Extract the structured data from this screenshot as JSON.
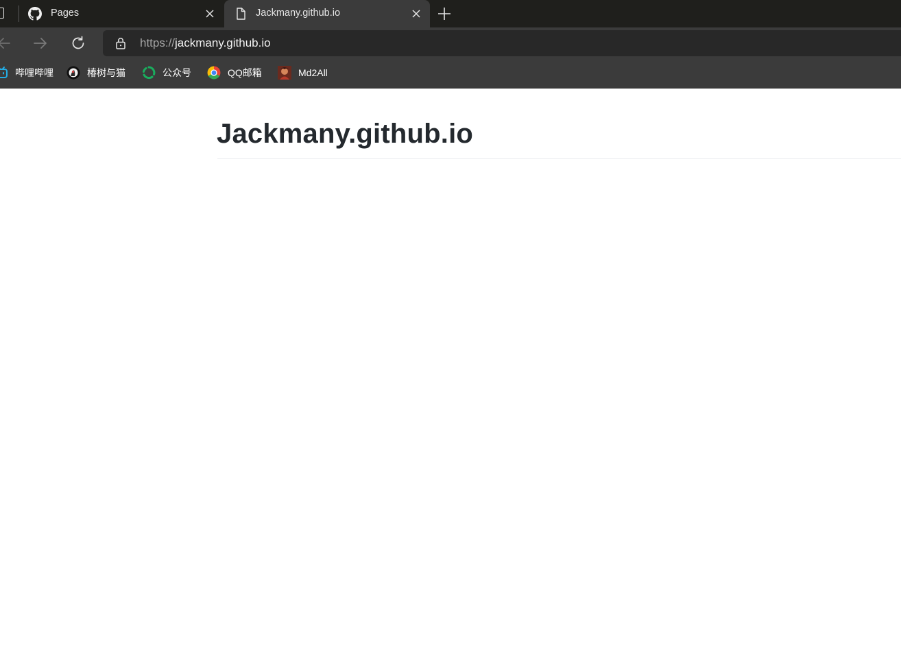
{
  "tabs": [
    {
      "label": "Pages",
      "icon": "github-icon",
      "active": false
    },
    {
      "label": "Jackmany.github.io",
      "icon": "file-icon",
      "active": true
    }
  ],
  "address_bar": {
    "scheme": "https://",
    "host": "jackmany.github.io"
  },
  "bookmarks": [
    {
      "label": "哔哩哔哩",
      "icon": "bilibili-icon"
    },
    {
      "label": "椿树与猫",
      "icon": "avatar-icon"
    },
    {
      "label": "公众号",
      "icon": "wechat-official-icon"
    },
    {
      "label": "QQ邮箱",
      "icon": "qq-mail-icon"
    },
    {
      "label": "Md2All",
      "icon": "md2all-icon"
    }
  ],
  "page": {
    "title": "Jackmany.github.io"
  },
  "colors": {
    "tabstrip_bg": "#1f1f1c",
    "toolbar_bg": "#3b3b3b",
    "address_bg": "#282828",
    "heading": "#24292e"
  }
}
